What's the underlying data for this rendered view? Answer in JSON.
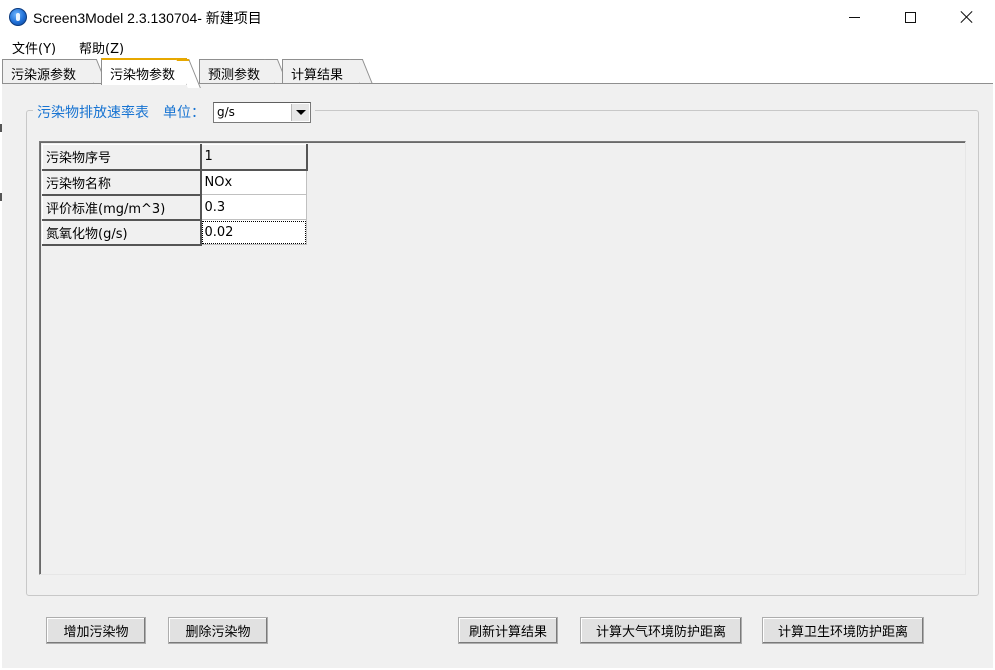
{
  "window": {
    "title": "Screen3Model 2.3.130704- 新建项目"
  },
  "menu": {
    "file": "文件(Y)",
    "help": "帮助(Z)"
  },
  "tabs": [
    {
      "label": "污染源参数",
      "active": false
    },
    {
      "label": "污染物参数",
      "active": true
    },
    {
      "label": "预测参数",
      "active": false
    },
    {
      "label": "计算结果",
      "active": false
    }
  ],
  "emission": {
    "group_title": "污染物排放速率表",
    "unit_label": "单位：",
    "unit_value": "g/s"
  },
  "grid": {
    "rows": [
      {
        "label": "污染物序号",
        "value": "1"
      },
      {
        "label": "污染物名称",
        "value": "NOx"
      },
      {
        "label": "评价标准(mg/m^3)",
        "value": "0.3"
      },
      {
        "label": "氮氧化物(g/s)",
        "value": "0.02"
      }
    ]
  },
  "buttons": {
    "add": "增加污染物",
    "delete": "删除污染物",
    "refresh": "刷新计算结果",
    "atmos": "计算大气环境防护距离",
    "health": "计算卫生环境防护距离"
  },
  "colors": {
    "accent_blue": "#1874d2",
    "active_tab_border": "#e7a800"
  }
}
